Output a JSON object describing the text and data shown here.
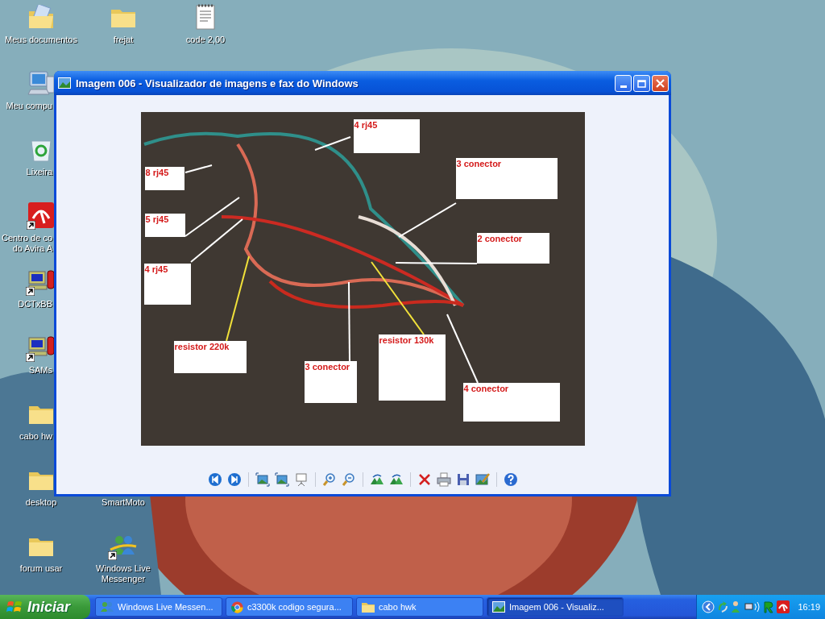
{
  "desktop": {
    "columns": [
      {
        "top": [
          {
            "label": "Meus documentos",
            "kind": "mydocs",
            "shortcut": false
          },
          {
            "label": "Meu compu",
            "kind": "computer",
            "shortcut": false
          },
          {
            "label": "Lixeira",
            "kind": "recycle",
            "shortcut": false
          },
          {
            "label": "Centro de co\ndo Avira A",
            "kind": "avira",
            "shortcut": true
          },
          {
            "label": "DCTxBB",
            "kind": "phoneapp",
            "shortcut": true
          },
          {
            "label": "SAMs",
            "kind": "phoneapp",
            "shortcut": true
          },
          {
            "label": "cabo hw",
            "kind": "folder",
            "shortcut": false
          },
          {
            "label": "desktop",
            "kind": "folder",
            "shortcut": false
          },
          {
            "label": "forum usar",
            "kind": "folder",
            "shortcut": false
          }
        ]
      },
      {
        "top": [
          {
            "label": "frejat",
            "kind": "folder",
            "shortcut": false
          }
        ],
        "bottom": [
          {
            "label": "SmartMoto",
            "kind": "covered"
          },
          {
            "label": "Windows Live\nMessenger",
            "kind": "messenger",
            "shortcut": true
          }
        ]
      },
      {
        "top": [
          {
            "label": "code 2,00",
            "kind": "document",
            "shortcut": false
          }
        ]
      }
    ]
  },
  "window": {
    "title": "Imagem 006 - Visualizador de imagens e fax do Windows",
    "image": {
      "callouts": [
        {
          "label": "4 rj45",
          "color": "#ffffff"
        },
        {
          "label": "3 conector",
          "color": "#ffffff"
        },
        {
          "label": "8 rj45",
          "color": "#ffffff"
        },
        {
          "label": "5 rj45",
          "color": "#ffffff"
        },
        {
          "label": "2 conector",
          "color": "#ffffff"
        },
        {
          "label": "4 rj45",
          "color": "#ffffff"
        },
        {
          "label": "resistor 220k",
          "color": "#f2e23a"
        },
        {
          "label": "3 conector",
          "color": "#ffffff"
        },
        {
          "label": "resistor 130k",
          "color": "#f2e23a"
        },
        {
          "label": "4 conector",
          "color": "#ffffff"
        }
      ]
    }
  },
  "taskbar": {
    "start": "Iniciar",
    "tasks": [
      {
        "label": "Windows Live Messen...",
        "kind": "messenger",
        "selected": false
      },
      {
        "label": "c3300k codigo segura...",
        "kind": "browser",
        "selected": false
      },
      {
        "label": "cabo hwk",
        "kind": "folder",
        "selected": false
      },
      {
        "label": "Imagem 006 - Visualiz...",
        "kind": "image",
        "selected": true
      }
    ],
    "clock": "16:19"
  }
}
